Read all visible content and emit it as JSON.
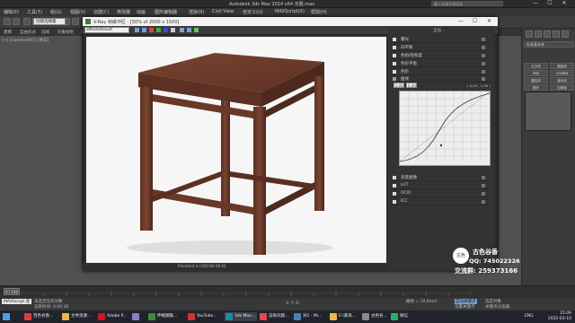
{
  "window": {
    "title": "Autodesk 3ds Max  2014 x64    无题.max",
    "search_placeholder": "键入关键字或短语",
    "min": "—",
    "max": "☐",
    "close": "✕"
  },
  "menu": [
    "编辑(E)",
    "工具(T)",
    "组(G)",
    "视图(V)",
    "创建(C)",
    "修改器",
    "动画",
    "图形编辑器",
    "渲染(R)",
    "Civil View",
    "自定义(U)",
    "MAXScript(X)",
    "帮助(H)"
  ],
  "toolbar": {
    "selection_set": "创建选择集"
  },
  "ribbon": [
    "建模",
    "自由形式",
    "选择",
    "对象绘制",
    "填充"
  ],
  "viewport": {
    "label": "[+] [Camera001] [真实]"
  },
  "vfb": {
    "title": "V-Ray 帧缓冲区 - [50% of 2000 x 1500]",
    "channel": "effectsResult",
    "status": "Finished in [00:06:16.0]",
    "panel_header": "全局...",
    "rows_top": [
      {
        "label": "曝光",
        "checked": false
      },
      {
        "label": "白平衡",
        "checked": false
      },
      {
        "label": "色相/饱和度",
        "checked": false
      },
      {
        "label": "色彩平衡",
        "checked": false
      },
      {
        "label": "色阶",
        "checked": false
      },
      {
        "label": "曲线",
        "checked": true
      }
    ],
    "curve_in": "0.00",
    "curve_out": "0.00",
    "curve_range": "( 0.00 , 1.00 )",
    "rows_bottom": [
      {
        "label": "背景图像",
        "checked": false
      },
      {
        "label": "LUT",
        "checked": false
      },
      {
        "label": "OCIO",
        "checked": false
      },
      {
        "label": "ICC",
        "checked": false
      }
    ]
  },
  "cmdpanel": {
    "name_field": "标准基本体",
    "buttons": [
      "长方体",
      "圆锥体",
      "球体",
      "几何球体",
      "圆柱体",
      "管状体",
      "圆环",
      "四棱锥",
      "茶壶",
      "平面"
    ]
  },
  "watermark": {
    "logo_text": "古色",
    "brand": "古色谷香",
    "qq": "QQ: 745022326",
    "group": "交流群: 259373166"
  },
  "timeline": {
    "frame": "0 / 100"
  },
  "status": {
    "script": "MAXScript 迷",
    "msg1": "未选定任何对象",
    "msg2": "渲染时间: 0:06:16",
    "coords": "X:  Y:  Z:",
    "grid": "栅格 = 10.0mm",
    "autokey": "自动关键点",
    "selected": "选定对象",
    "setkey": "设置关键点",
    "filters": "关键点过滤器..."
  },
  "taskbar": {
    "apps": [
      {
        "label": "百色谷香...",
        "color": "#d94040"
      },
      {
        "label": "文件资源...",
        "color": "#e8b84a"
      },
      {
        "label": "Adobe P...",
        "color": "#c01a2c"
      },
      {
        "label": "Pr",
        "color": "#8e7cc3"
      },
      {
        "label": "伸缩钢筋...",
        "color": "#3c8c3c"
      },
      {
        "label": "YouTube...",
        "color": "#d23030"
      },
      {
        "label": "3ds Max...",
        "color": "#1d8a9e"
      },
      {
        "label": "渲染问题...",
        "color": "#e04a4a"
      },
      {
        "label": "对2 - Mi...",
        "color": "#4a7fc0"
      },
      {
        "label": "E:\\家具...",
        "color": "#e8b84a"
      },
      {
        "label": "古色谷...",
        "color": "#888"
      },
      {
        "label": "微信",
        "color": "#2aae67"
      }
    ],
    "time": "15:09",
    "date": "2022-03-10",
    "lang": "ENG"
  },
  "colors": {
    "accent": "#7aa0d8",
    "render_bg": "#f6f6f6",
    "wood": "#6b3a27"
  }
}
